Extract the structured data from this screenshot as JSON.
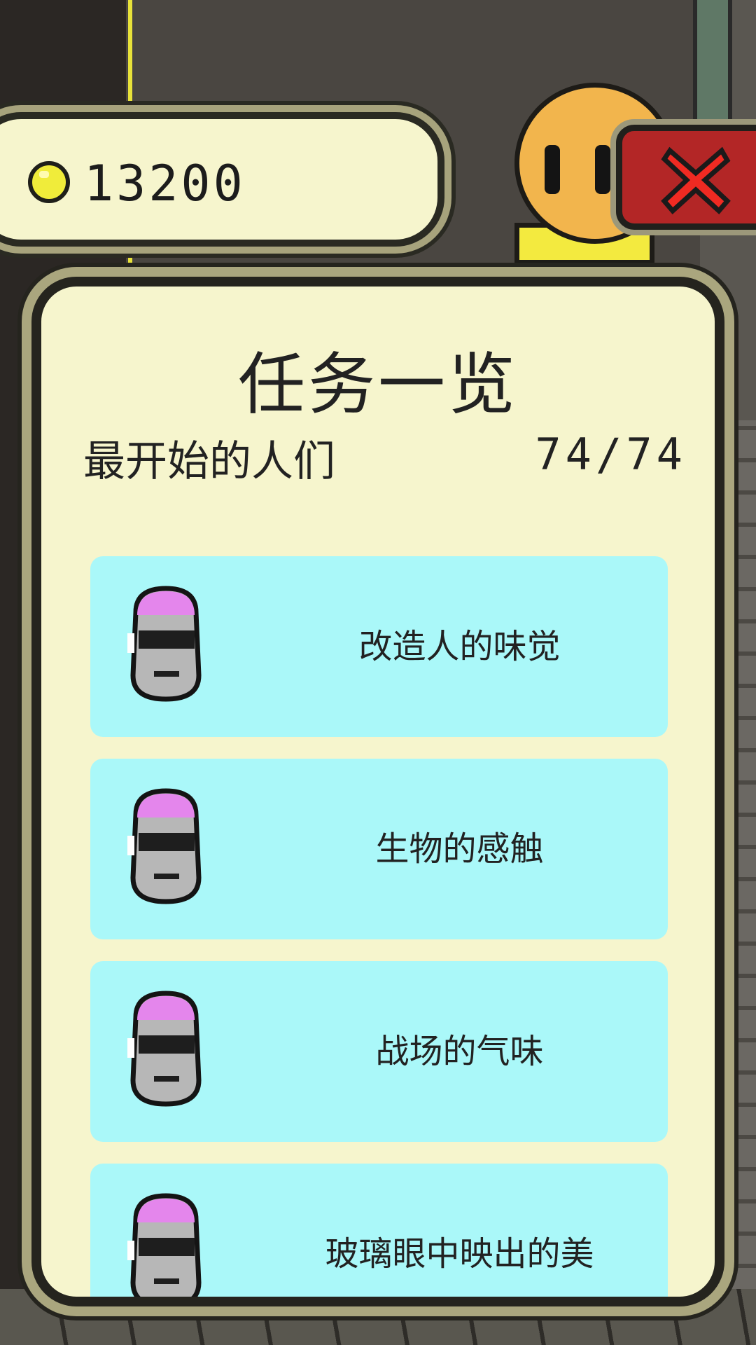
{
  "currency": {
    "icon": "gold-coin-icon",
    "value": "13200"
  },
  "close_button": {
    "icon": "close-x-icon"
  },
  "panel": {
    "title": "任务一览",
    "subtitle": "最开始的人们",
    "count": "74/74"
  },
  "quests": [
    {
      "label": "改造人的味觉",
      "icon": "robot-helmet-icon"
    },
    {
      "label": "生物的感触",
      "icon": "robot-helmet-icon"
    },
    {
      "label": "战场的气味",
      "icon": "robot-helmet-icon"
    },
    {
      "label": "玻璃眼中映出的美",
      "icon": "robot-helmet-icon"
    }
  ],
  "colors": {
    "panel_bg": "#f6f5cd",
    "quest_bg": "#aaf8f9",
    "close_bg": "#b32626",
    "coin": "#f0ec3a"
  }
}
